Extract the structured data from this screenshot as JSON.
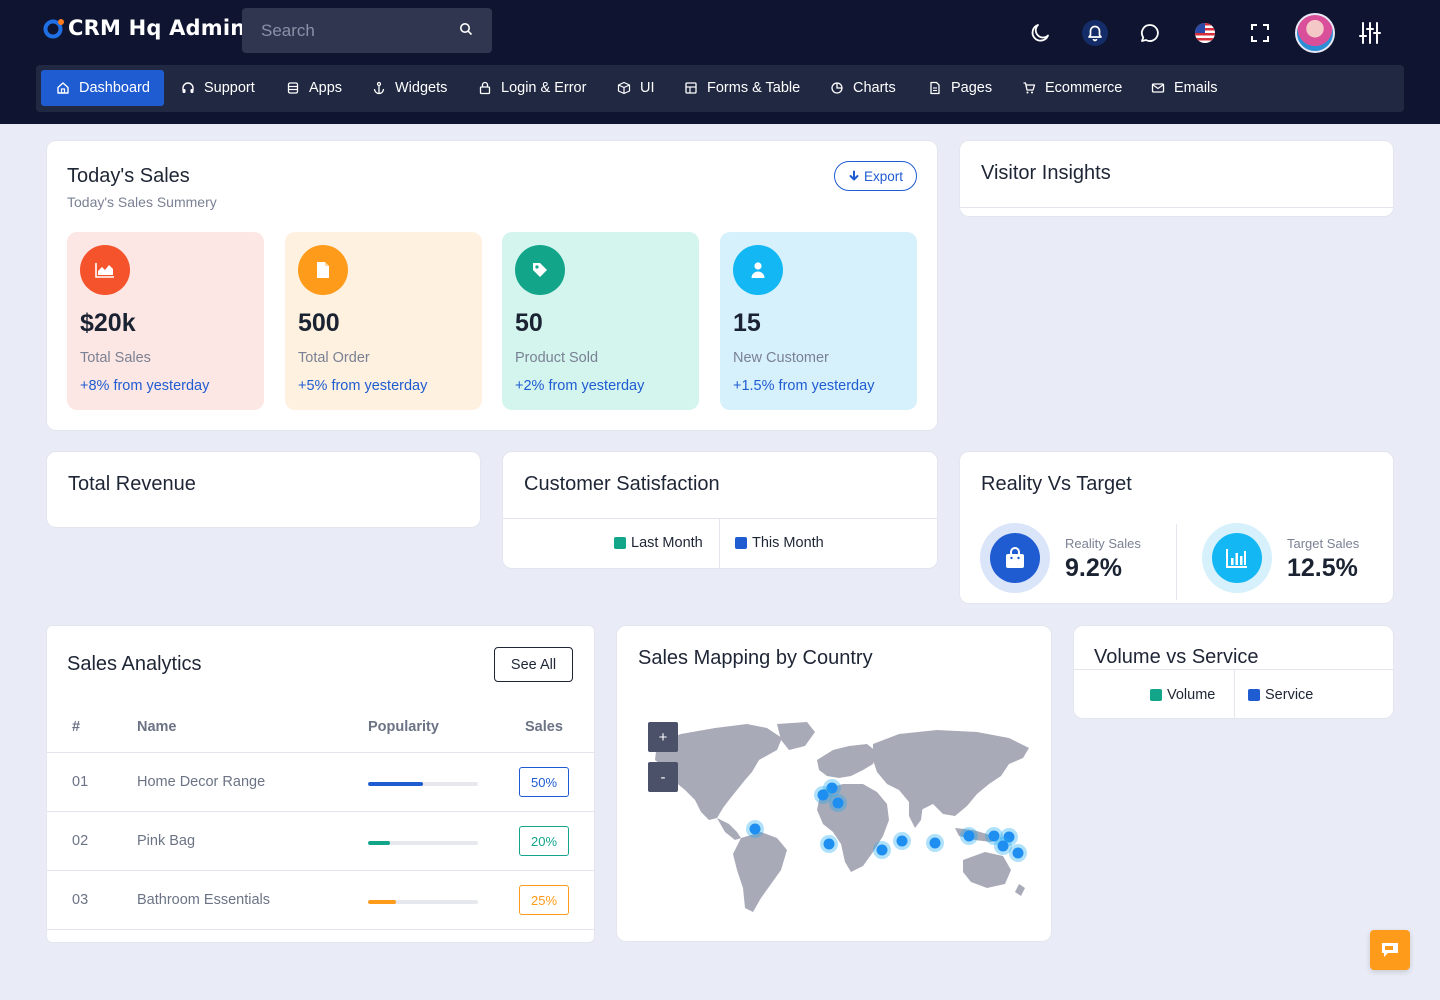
{
  "app": {
    "title": "CRM Hq Admin"
  },
  "search": {
    "placeholder": "Search"
  },
  "header_icons": [
    "moon-icon",
    "bell-icon",
    "chat-icon",
    "us-flag-icon",
    "fullscreen-icon",
    "avatar",
    "sliders-icon"
  ],
  "nav": {
    "items": [
      {
        "label": "Dashboard",
        "icon": "home-icon",
        "active": true
      },
      {
        "label": "Support",
        "icon": "headset-icon"
      },
      {
        "label": "Apps",
        "icon": "database-icon"
      },
      {
        "label": "Widgets",
        "icon": "anchor-icon"
      },
      {
        "label": "Login & Error",
        "icon": "lock-icon"
      },
      {
        "label": "UI",
        "icon": "box-icon"
      },
      {
        "label": "Forms & Table",
        "icon": "table-icon"
      },
      {
        "label": "Charts",
        "icon": "pie-icon"
      },
      {
        "label": "Pages",
        "icon": "page-icon"
      },
      {
        "label": "Ecommerce",
        "icon": "cart-icon"
      },
      {
        "label": "Emails",
        "icon": "mail-icon"
      }
    ]
  },
  "todays_sales": {
    "title": "Today's Sales",
    "subtitle": "Today's Sales Summery",
    "export_label": "Export",
    "stats": [
      {
        "value": "$20k",
        "label": "Total Sales",
        "change": "+8% from yesterday",
        "icon": "chart-area-icon",
        "bg": "#fde7e4",
        "icon_bg": "#f4532c"
      },
      {
        "value": "500",
        "label": "Total Order",
        "change": "+5% from yesterday",
        "icon": "file-icon",
        "bg": "#fff1e0",
        "icon_bg": "#ff9b1a"
      },
      {
        "value": "50",
        "label": "Product Sold",
        "change": "+2% from yesterday",
        "icon": "tag-icon",
        "bg": "#d3f5ee",
        "icon_bg": "#12a58a"
      },
      {
        "value": "15",
        "label": "New Customer",
        "change": "+1.5% from yesterday",
        "icon": "user-icon",
        "bg": "#d6f1fc",
        "icon_bg": "#12b7f3"
      }
    ]
  },
  "visitor_insights": {
    "title": "Visitor Insights"
  },
  "total_revenue": {
    "title": "Total Revenue"
  },
  "customer_satisfaction": {
    "title": "Customer Satisfaction",
    "legend": [
      {
        "label": "Last Month",
        "color": "#12a58a"
      },
      {
        "label": "This Month",
        "color": "#1f5cd1"
      }
    ]
  },
  "reality_vs_target": {
    "title": "Reality Vs Target",
    "items": [
      {
        "label": "Reality Sales",
        "value": "9.2%",
        "icon": "shopping-bag-icon",
        "color": "#1f5cd1",
        "ring": "#dbe5f9"
      },
      {
        "label": "Target Sales",
        "value": "12.5%",
        "icon": "bar-chart-icon",
        "color": "#12b7f3",
        "ring": "#d6f1fc"
      }
    ]
  },
  "sales_analytics": {
    "title": "Sales Analytics",
    "see_all_label": "See All",
    "columns": [
      "#",
      "Name",
      "Popularity",
      "Sales"
    ],
    "rows": [
      {
        "num": "01",
        "name": "Home Decor Range",
        "popularity": 0.5,
        "sales": "50%",
        "color": "#1f5cd1"
      },
      {
        "num": "02",
        "name": "Pink Bag",
        "popularity": 0.2,
        "sales": "20%",
        "color": "#12a58a"
      },
      {
        "num": "03",
        "name": "Bathroom Essentials",
        "popularity": 0.25,
        "sales": "25%",
        "color": "#ff9b1a"
      }
    ]
  },
  "sales_mapping": {
    "title": "Sales Mapping by Country",
    "zoom_in_label": "+",
    "zoom_out_label": "-",
    "marker_color": "#1eaaf1"
  },
  "volume_vs_service": {
    "title": "Volume vs Service",
    "legend": [
      {
        "label": "Volume",
        "color": "#12a58a"
      },
      {
        "label": "Service",
        "color": "#1f5cd1"
      }
    ]
  },
  "chat_fab": {
    "icon": "chat-bubble-icon",
    "color": "#ff9b1a"
  }
}
